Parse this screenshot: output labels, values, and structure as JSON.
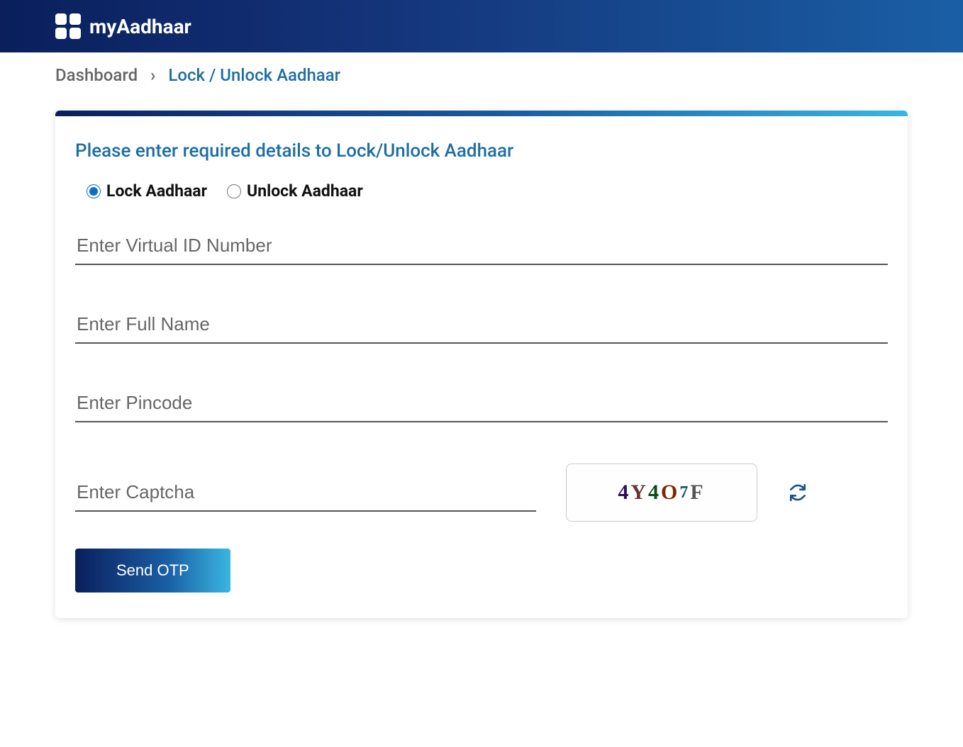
{
  "header": {
    "logo_text": "myAadhaar"
  },
  "breadcrumb": {
    "prev": "Dashboard",
    "sep": "›",
    "current": "Lock / Unlock Aadhaar"
  },
  "card": {
    "title": "Please enter required details to Lock/Unlock Aadhaar",
    "radio": {
      "lock_label": "Lock Aadhaar",
      "unlock_label": "Unlock Aadhaar",
      "selected": "lock"
    },
    "fields": {
      "vid_placeholder": "Enter Virtual ID Number",
      "name_placeholder": "Enter Full Name",
      "pin_placeholder": "Enter Pincode",
      "captcha_placeholder": "Enter Captcha"
    },
    "captcha_value": "4Y4O7F",
    "submit_label": "Send OTP"
  }
}
